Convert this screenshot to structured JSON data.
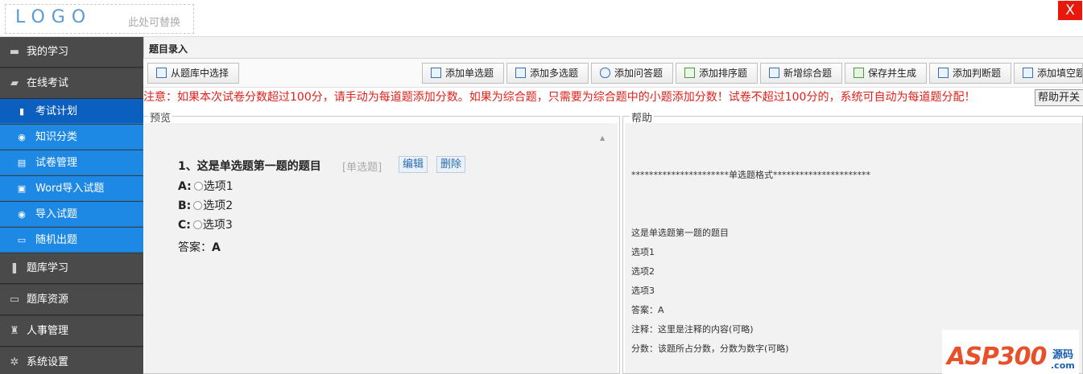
{
  "header": {
    "logo": "LOGO",
    "logo_sub": "此处可替换",
    "close": "X"
  },
  "sidebar": {
    "items": [
      {
        "label": "我的学习",
        "icon": "folder-icon"
      },
      {
        "label": "在线考试",
        "icon": "folder-open-icon"
      },
      {
        "label": "考试计划",
        "icon": "clipboard-icon"
      },
      {
        "label": "知识分类",
        "icon": "database-icon"
      },
      {
        "label": "试卷管理",
        "icon": "document-icon"
      },
      {
        "label": "Word导入试题",
        "icon": "image-icon"
      },
      {
        "label": "导入试题",
        "icon": "database-icon"
      },
      {
        "label": "随机出题",
        "icon": "monitor-icon"
      },
      {
        "label": "题库学习",
        "icon": "book-icon"
      },
      {
        "label": "题库资源",
        "icon": "monitor-icon"
      },
      {
        "label": "人事管理",
        "icon": "user-icon"
      },
      {
        "label": "系统设置",
        "icon": "gear-icon"
      }
    ]
  },
  "main": {
    "title": "题目录入",
    "toolbar": {
      "from_bank": "从题库中选择",
      "single": "添加单选题",
      "multi": "添加多选题",
      "qa": "添加问答题",
      "sort": "添加排序题",
      "combo": "新增综合题",
      "save": "保存并生成",
      "judge": "添加判断题",
      "fill": "添加填空题"
    },
    "notice": "注意：如果本次试卷分数超过100分，请手动为每道题添加分数。如果为综合题，只需要为综合题中的小题添加分数！试卷不超过100分的，系统可自动为每道题分配！",
    "help_toggle": "帮助开关",
    "preview": {
      "legend": "预览",
      "scroll_arrow": "▲",
      "question_title": "1、这是单选题第一题的题目",
      "question_type": "[单选题]",
      "edit": "编辑",
      "delete": "删除",
      "options": [
        {
          "key": "A:",
          "text": "选项1"
        },
        {
          "key": "B:",
          "text": "选项2"
        },
        {
          "key": "C:",
          "text": "选项3"
        }
      ],
      "answer_label": "答案：",
      "answer_value": "A"
    },
    "help": {
      "legend": "帮助",
      "lines": [
        "**********************单选题格式**********************",
        "这是单选题第一题的题目",
        "选项1",
        "选项2",
        "选项3",
        "答案：A",
        "注释：这里是注释的内容(可略)",
        "分数：该题所占分数，分数为数字(可略)",
        "......"
      ]
    }
  },
  "watermark": {
    "brand": "ASP300",
    "cn": "源码",
    "domain": ".com"
  }
}
